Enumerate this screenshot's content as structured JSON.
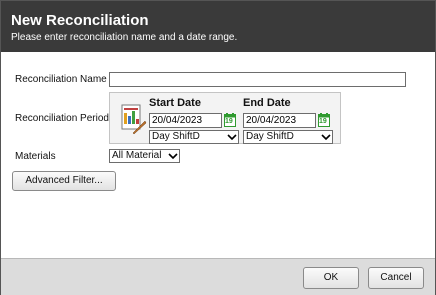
{
  "dialog": {
    "title": "New Reconciliation",
    "subtitle": "Please enter reconciliation name and a date range."
  },
  "form": {
    "name_label": "Reconciliation Name",
    "name_value": "",
    "period_label": "Reconciliation Period",
    "start": {
      "heading": "Start Date",
      "date": "20/04/2023",
      "shift": "Day ShiftD",
      "calendar_day": "19"
    },
    "end": {
      "heading": "End Date",
      "date": "20/04/2023",
      "shift": "Day ShiftD",
      "calendar_day": "19"
    },
    "materials_label": "Materials",
    "materials_value": "All Material",
    "advanced_filter_label": "Advanced Filter..."
  },
  "footer": {
    "ok_label": "OK",
    "cancel_label": "Cancel"
  },
  "colors": {
    "header_bg": "#3a3a3a",
    "footer_bg": "#dcdcdc",
    "calendar_green": "#2f9a2f"
  }
}
